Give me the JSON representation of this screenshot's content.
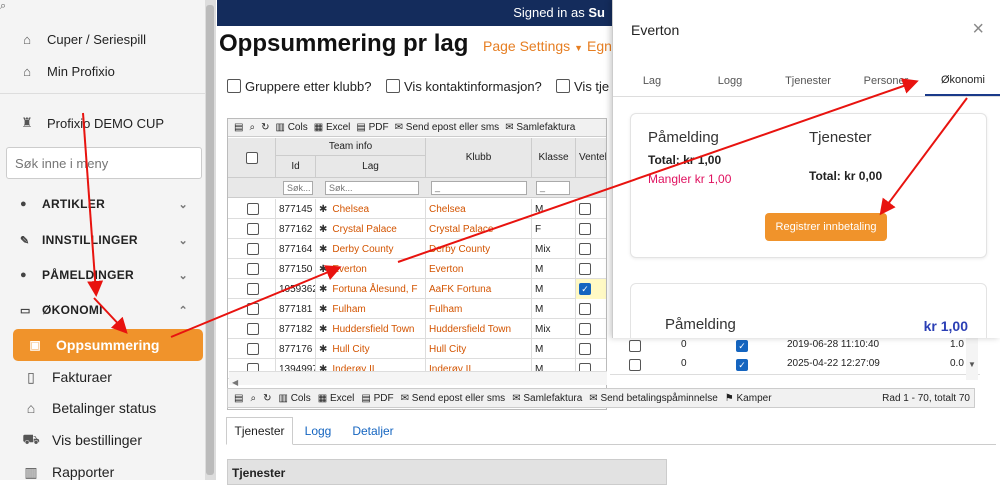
{
  "sidebar": {
    "top_items": [
      {
        "icon": "home-icon",
        "label": "Cuper / Seriespill"
      },
      {
        "icon": "home-icon",
        "label": "Min Profixio"
      }
    ],
    "cup": {
      "icon": "trophy-icon",
      "label": "Profixio DEMO CUP"
    },
    "search_placeholder": "Søk inne i meny",
    "sections": [
      {
        "icon": "info-icon",
        "label": "ARTIKLER",
        "chevron": "chevron-down-icon"
      },
      {
        "icon": "wrench-icon",
        "label": "INNSTILLINGER",
        "chevron": "chevron-down-icon"
      },
      {
        "icon": "users-icon",
        "label": "PÅMELDINGER",
        "chevron": "chevron-down-icon"
      },
      {
        "icon": "money-icon",
        "label": "ØKONOMI",
        "chevron": "chevron-up-icon"
      }
    ],
    "active_item": {
      "icon": "money-icon",
      "label": "Oppsummering"
    },
    "sub_items": [
      {
        "icon": "file-icon",
        "label": "Fakturaer"
      },
      {
        "icon": "bank-icon",
        "label": "Betalinger status"
      },
      {
        "icon": "cart-icon",
        "label": "Vis bestillinger"
      },
      {
        "icon": "chart-icon",
        "label": "Rapporter"
      }
    ]
  },
  "topbar": {
    "signed_prefix": "Signed in as",
    "signed_name": "Su"
  },
  "page": {
    "title": "Oppsummering pr lag",
    "settings_link": "Page Settings",
    "other_link": "Egn",
    "checkboxes": [
      "Gruppere etter klubb?",
      "Vis kontaktinformasjon?",
      "Vis tje"
    ]
  },
  "grid": {
    "toolbar": [
      "Cols",
      "Excel",
      "PDF",
      "Send epost eller sms",
      "Samlefaktura"
    ],
    "team_info_header": "Team info",
    "headers": {
      "id": "Id",
      "lag": "Lag",
      "klubb": "Klubb",
      "klasse": "Klasse",
      "ventel": "Ventel"
    },
    "search_placeholder": "Søk...",
    "klubb_filter": "_",
    "klasse_filter": "_",
    "rows": [
      {
        "id": "877145",
        "lag": "Chelsea",
        "klubb": "Chelsea",
        "klasse": "M",
        "checked": false
      },
      {
        "id": "877162",
        "lag": "Crystal Palace",
        "klubb": "Crystal Palace",
        "klasse": "F",
        "checked": false
      },
      {
        "id": "877164",
        "lag": "Derby County",
        "klubb": "Derby County",
        "klasse": "Mix",
        "checked": false
      },
      {
        "id": "877150",
        "lag": "Everton",
        "klubb": "Everton",
        "klasse": "M",
        "checked": false
      },
      {
        "id": "1059362",
        "lag": "Fortuna  Ålesund, F",
        "klubb": "AaFK Fortuna",
        "klasse": "M",
        "checked": true
      },
      {
        "id": "877181",
        "lag": "Fulham",
        "klubb": "Fulham",
        "klasse": "M",
        "checked": false
      },
      {
        "id": "877182",
        "lag": "Huddersfield Town",
        "klubb": "Huddersfield Town",
        "klasse": "Mix",
        "checked": false
      },
      {
        "id": "877176",
        "lag": "Hull City",
        "klubb": "Hull City",
        "klasse": "M",
        "checked": false
      },
      {
        "id": "1394997",
        "lag": "Inderøy IL",
        "klubb": "Inderøy IL",
        "klasse": "M",
        "checked": false
      }
    ],
    "extra_rows": [
      {
        "num": "0",
        "date": "2019-06-28 11:10:40",
        "val": "1.0"
      },
      {
        "num": "0",
        "date": "2025-04-22 12:27:09",
        "val": "0.0"
      }
    ]
  },
  "bottom_toolbar": {
    "items": [
      "Cols",
      "Excel",
      "PDF",
      "Send epost eller sms",
      "Samlefaktura",
      "Send betalingspåminnelse",
      "Kamper"
    ],
    "info": "Rad 1 - 70, totalt 70"
  },
  "bottom_tabs": [
    "Tjenester",
    "Logg",
    "Detaljer"
  ],
  "tjenester_header": "Tjenester",
  "modal": {
    "title": "Everton",
    "tabs": [
      "Lag",
      "Logg",
      "Tjenester",
      "Personer",
      "Økonomi"
    ],
    "active_tab": "Økonomi",
    "card1": {
      "pamelding_heading": "Påmelding",
      "pamelding_total": "Total: kr 1,00",
      "mangler": "Mangler kr 1,00",
      "tjenester_heading": "Tjenester",
      "tjenester_total": "Total: kr 0,00",
      "button": "Registrer innbetaling"
    },
    "card2": {
      "heading": "Påmelding",
      "amount": "kr 1,00"
    }
  },
  "colors": {
    "accent": "#f0932b",
    "navy": "#142c5c",
    "link_orange": "#d35400",
    "missing_red": "#e0115f",
    "arrow_red": "#e8130f"
  }
}
